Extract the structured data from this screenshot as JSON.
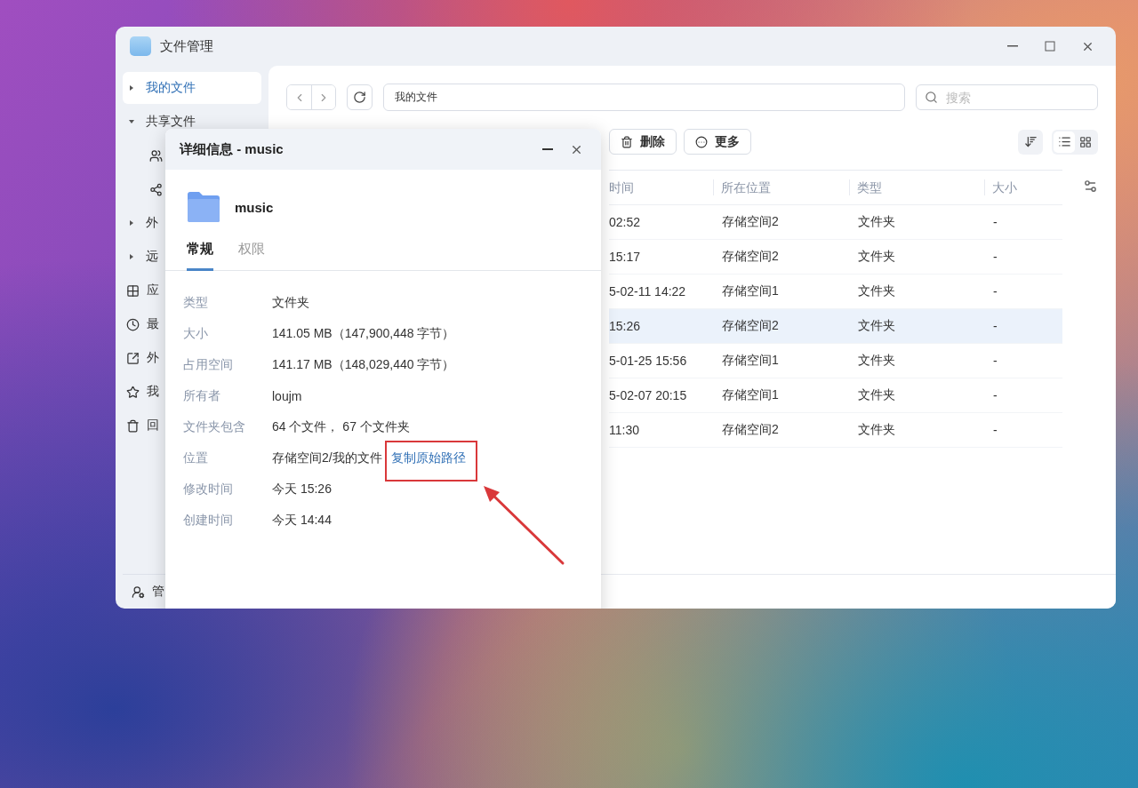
{
  "window": {
    "title": "文件管理"
  },
  "sidebar": {
    "items": [
      {
        "label": "我的文件",
        "kind": "caret",
        "expanded": false,
        "selected": true
      },
      {
        "label": "共享文件",
        "kind": "caret",
        "expanded": true,
        "selected": false,
        "children": [
          {
            "selected": false
          },
          {
            "selected": false
          }
        ]
      },
      {
        "label": "外",
        "kind": "caret",
        "expanded": false,
        "selected": false
      },
      {
        "label": "远",
        "kind": "caret",
        "expanded": false,
        "selected": false
      },
      {
        "label": "应",
        "kind": "icon",
        "selected": false
      },
      {
        "label": "最",
        "kind": "icon",
        "selected": false
      },
      {
        "label": "外",
        "kind": "icon",
        "selected": false
      },
      {
        "label": "我",
        "kind": "icon",
        "selected": false
      },
      {
        "label": "回",
        "kind": "icon",
        "selected": false
      }
    ],
    "footer": {
      "label": "管"
    }
  },
  "toolbar": {
    "path": "我的文件",
    "search": {
      "placeholder": "搜索"
    },
    "actions": [
      "删除",
      "更多"
    ],
    "view_modes": [
      {
        "kind": "list",
        "selected": true
      },
      {
        "kind": "grid",
        "selected": false
      }
    ]
  },
  "table": {
    "columns": [
      "时间",
      "所在位置",
      "类型",
      "大小"
    ],
    "rows": [
      {
        "cells": [
          "02:52",
          "存储空间2",
          "文件夹",
          "-"
        ],
        "selected": false
      },
      {
        "cells": [
          "15:17",
          "存储空间2",
          "文件夹",
          "-"
        ],
        "selected": false
      },
      {
        "cells": [
          "5-02-11 14:22",
          "存储空间1",
          "文件夹",
          "-"
        ],
        "selected": false
      },
      {
        "cells": [
          "15:26",
          "存储空间2",
          "文件夹",
          "-"
        ],
        "selected": true
      },
      {
        "cells": [
          "5-01-25 15:56",
          "存储空间1",
          "文件夹",
          "-"
        ],
        "selected": false
      },
      {
        "cells": [
          "5-02-07 20:15",
          "存储空间1",
          "文件夹",
          "-"
        ],
        "selected": false
      },
      {
        "cells": [
          "11:30",
          "存储空间2",
          "文件夹",
          "-"
        ],
        "selected": false
      }
    ]
  },
  "dialog": {
    "title": "详细信息 - music",
    "name": "music",
    "tabs": [
      {
        "label": "常规",
        "selected": true
      },
      {
        "label": "权限",
        "selected": false
      }
    ],
    "properties": [
      {
        "label": "类型",
        "value": "文件夹"
      },
      {
        "label": "大小",
        "value": "141.05 MB（147,900,448 字节）"
      },
      {
        "label": "占用空间",
        "value": "141.17 MB（148,029,440 字节）"
      },
      {
        "label": "所有者",
        "value": "loujm"
      },
      {
        "label": "文件夹包含",
        "value": "64 个文件， 67 个文件夹"
      },
      {
        "label": "位置",
        "value": "存储空间2/我的文件",
        "link": "复制原始路径"
      },
      {
        "label": "修改时间",
        "value": "今天 15:26"
      },
      {
        "label": "创建时间",
        "value": "今天 14:44"
      }
    ]
  }
}
